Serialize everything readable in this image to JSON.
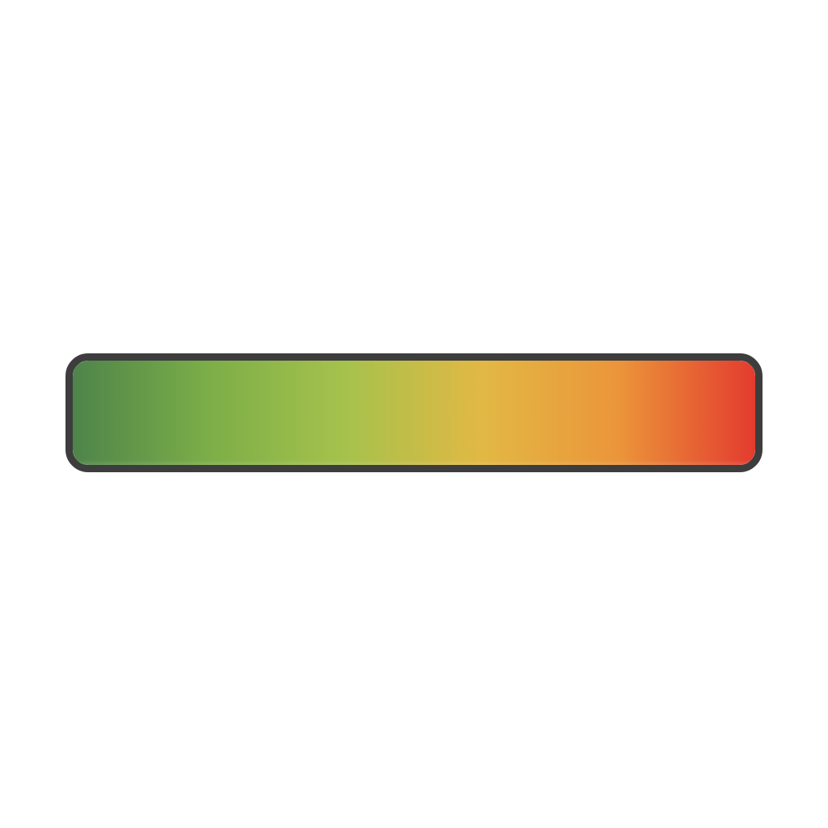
{
  "gradient_bar": {
    "stops": [
      "#4e844a",
      "#7cae48",
      "#a6c24c",
      "#e2b844",
      "#eb953a",
      "#e33b2f"
    ],
    "border_color": "#3d3d3d",
    "direction": "left-to-right"
  }
}
